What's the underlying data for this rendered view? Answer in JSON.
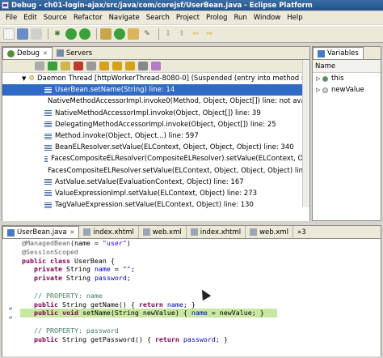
{
  "window": {
    "title": "Debug - ch01-login-ajax/src/java/com/corejsf/UserBean.java - Eclipse Platform"
  },
  "menu": [
    "File",
    "Edit",
    "Source",
    "Refactor",
    "Navigate",
    "Search",
    "Project",
    "Prolog",
    "Run",
    "Window",
    "Help"
  ],
  "debug_view": {
    "tabs": [
      {
        "label": "Debug",
        "active": true,
        "closable": true
      },
      {
        "label": "Servers",
        "active": false,
        "closable": false
      }
    ],
    "thread": "Daemon Thread [httpWorkerThread-8080-0] (Suspended (entry into method setN",
    "frames": [
      "UserBean.setName(String) line: 14",
      "NativeMethodAccessorImpl.invoke0(Method, Object, Object[]) line: not availabl",
      "NativeMethodAccessorImpl.invoke(Object, Object[]) line: 39",
      "DelegatingMethodAccessorImpl.invoke(Object, Object[]) line: 25",
      "Method.invoke(Object, Object...) line: 597",
      "BeanELResolver.setValue(ELContext, Object, Object, Object) line: 340",
      "FacesCompositeELResolver(CompositeELResolver).setValue(ELContext, Obj",
      "FacesCompositeELResolver.setValue(ELContext, Object, Object, Object) line: 1",
      "AstValue.setValue(EvaluationContext, Object) line: 167",
      "ValueExpressionImpl.setValue(ELContext, Object) line: 273",
      "TagValueExpression.setValue(ELContext, Object) line: 130"
    ],
    "selected_index": 0
  },
  "variables_view": {
    "tab": "Variables",
    "column": "Name",
    "vars": [
      {
        "name": "this",
        "color": "#3aa13a"
      },
      {
        "name": "newValue",
        "color": "#d4d0c8"
      }
    ]
  },
  "editor": {
    "tabs": [
      {
        "label": "UserBean.java",
        "active": true
      },
      {
        "label": "index.xhtml",
        "active": false
      },
      {
        "label": "web.xml",
        "active": false
      },
      {
        "label": "index.xhtml",
        "active": false
      },
      {
        "label": "web.xml",
        "active": false
      }
    ],
    "overflow": "»3",
    "highlight_color": "#c8e8a0"
  }
}
